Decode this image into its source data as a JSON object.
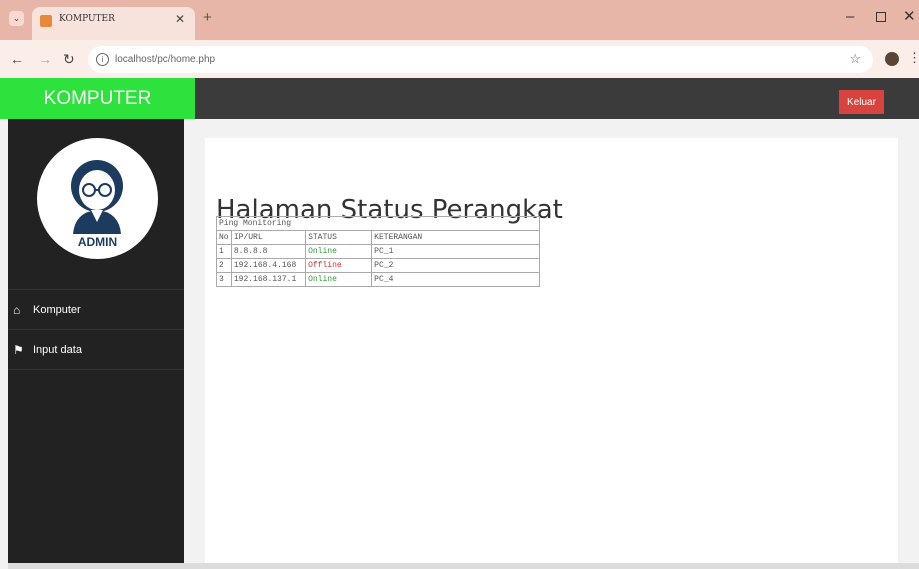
{
  "browser": {
    "tab_title": "KOMPUTER",
    "url": "localhost/pc/home.php"
  },
  "header": {
    "brand": "KOMPUTER",
    "logout_label": "Keluar"
  },
  "sidebar": {
    "avatar_label": "ADMIN",
    "items": [
      {
        "label": "Komputer",
        "icon": "home-icon"
      },
      {
        "label": "Input data",
        "icon": "flag-icon"
      }
    ]
  },
  "main": {
    "title": "Halaman Status Perangkat",
    "table": {
      "caption": "Ping Monitoring",
      "headers": [
        "No",
        "IP/URL",
        "STATUS",
        "KETERANGAN"
      ],
      "rows": [
        {
          "no": "1",
          "ip": "8.8.8.8",
          "status": "Online",
          "keterangan": "PC_1"
        },
        {
          "no": "2",
          "ip": "192.168.4.168",
          "status": "Offline",
          "keterangan": "PC_2"
        },
        {
          "no": "3",
          "ip": "192.168.137.1",
          "status": "Online",
          "keterangan": "PC_4"
        }
      ]
    }
  },
  "colors": {
    "brand": "#2ee23d",
    "header": "#3b3b3b",
    "sidebar": "#222222",
    "logout": "#d9433d",
    "online": "#3a9a3a",
    "offline": "#cc3333"
  }
}
